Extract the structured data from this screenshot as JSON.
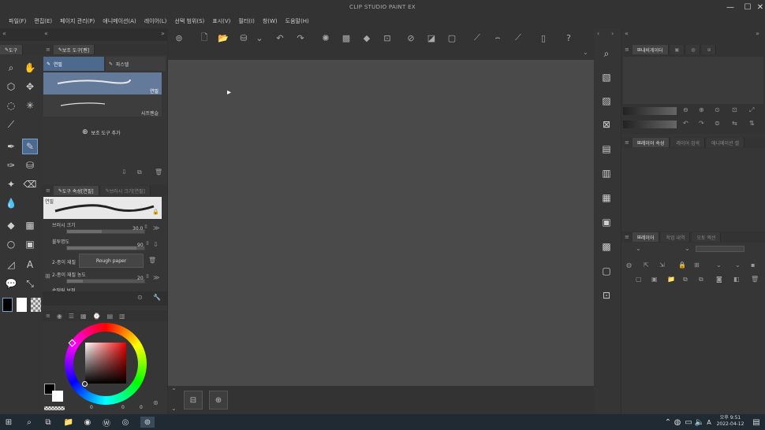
{
  "window": {
    "title": "CLIP STUDIO PAINT EX",
    "minimize": "—",
    "maximize": "☐",
    "close": "✕"
  },
  "menu": [
    "파일(F)",
    "편집(E)",
    "페이지 관리(P)",
    "애니메이션(A)",
    "레이어(L)",
    "선택 범위(S)",
    "표시(V)",
    "필터(I)",
    "창(W)",
    "도움말(H)"
  ],
  "tool_panel": {
    "tab_label": "도구"
  },
  "subtool_panel": {
    "tab_label": "보조 도구[펜]",
    "groups": [
      "연필",
      "파스텔"
    ],
    "brushes": [
      "연필",
      "샤프펜슬"
    ],
    "add_label": "보조 도구 추가"
  },
  "tool_property": {
    "tabs": [
      "도구 속성[연필]",
      "브러시 크기[연필]"
    ],
    "preview_label": "연필",
    "brush_size_label": "브러시 크기",
    "brush_size_value": "30.0",
    "brush_size_fraction": 0.45,
    "opacity_label": "불투명도",
    "opacity_value": "90",
    "opacity_fraction": 0.9,
    "paper_texture_label": "2-종이 재질",
    "paper_texture_value": "Rough paper",
    "paper_density_label": "2-종이 재질 농도",
    "paper_density_value": "20",
    "paper_density_fraction": 0.2,
    "stabilization_label": "손떨림 보정"
  },
  "color_panel": {
    "values": [
      "0",
      "0",
      "0"
    ]
  },
  "right_panel": {
    "navigator_tab": "내비게이터",
    "layer_prop_tabs": [
      "레이어 속성",
      "레이어 검색",
      "애니메이션 셀"
    ],
    "layer_tabs": [
      "레이어",
      "작업 내역",
      "오토 액션"
    ]
  },
  "taskbar": {
    "time": "오후 9:51",
    "date": "2022-04-12",
    "ime": "A"
  }
}
